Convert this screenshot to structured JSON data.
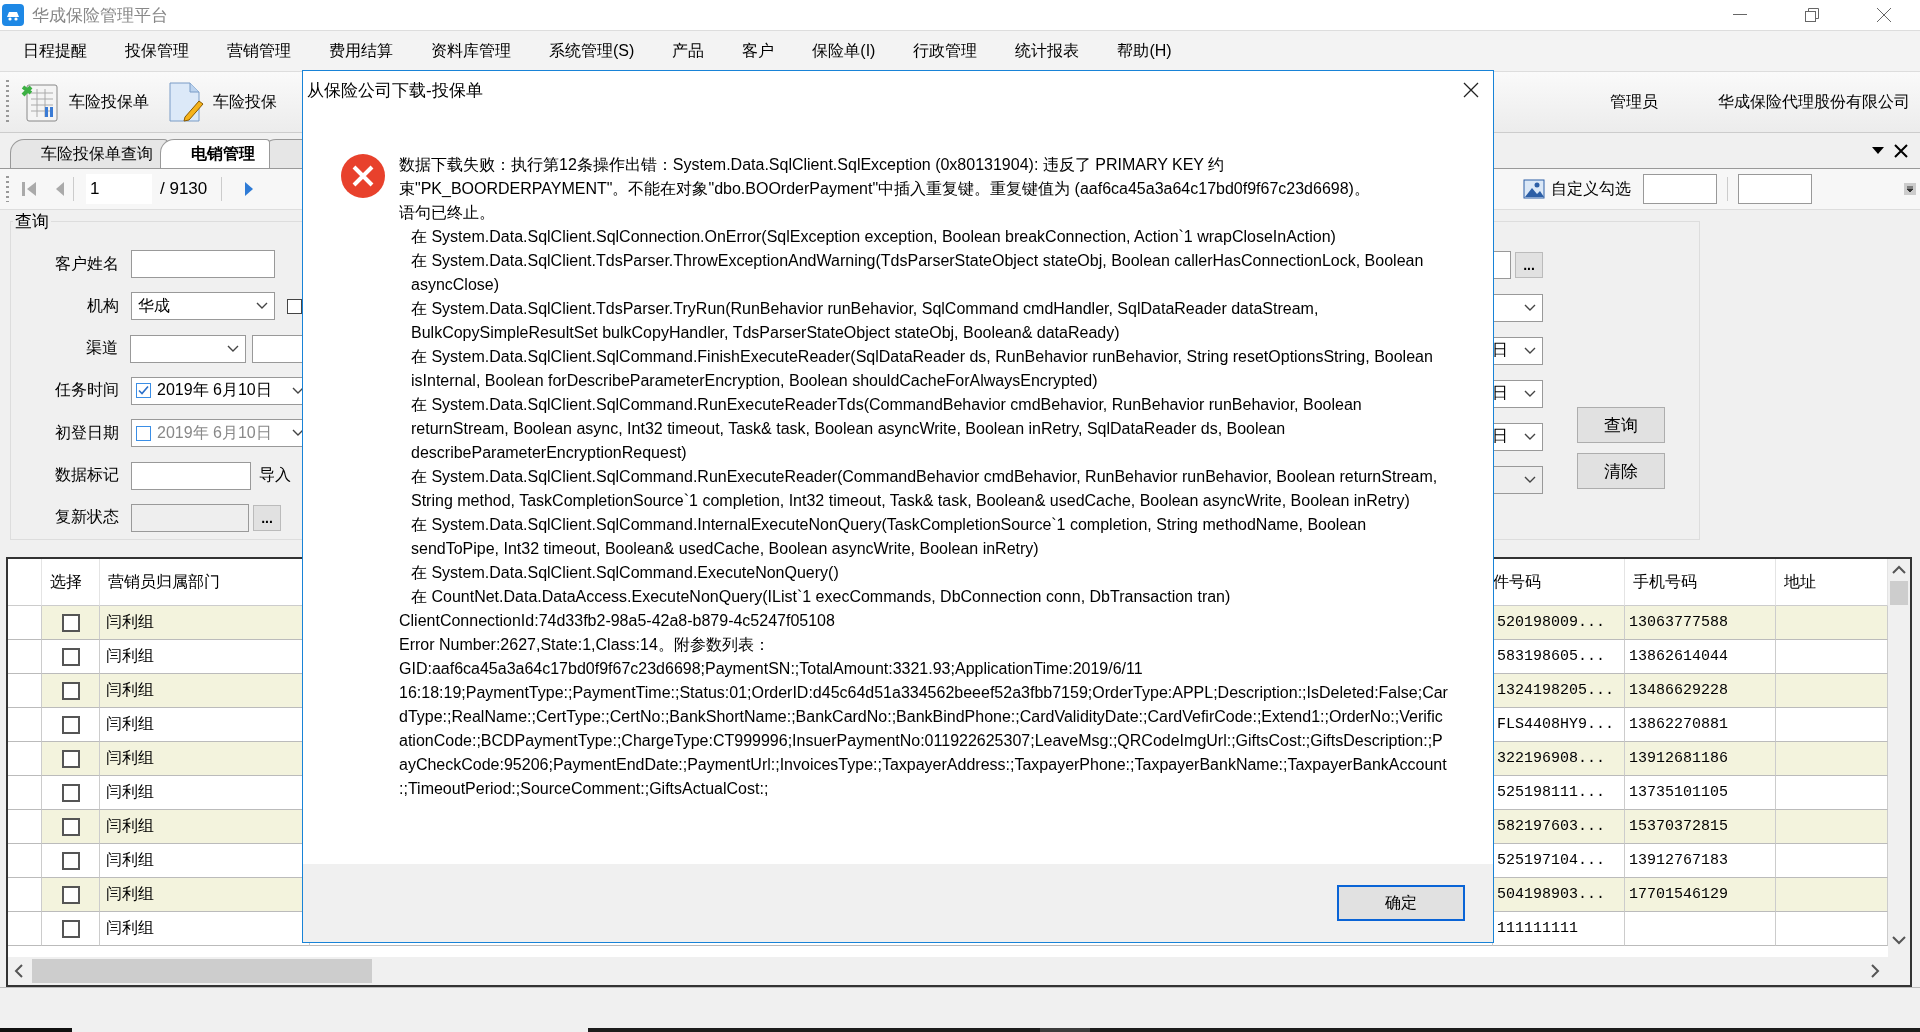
{
  "window": {
    "title": "华成保险管理平台"
  },
  "menu": [
    "日程提醒",
    "投保管理",
    "营销管理",
    "费用结算",
    "资料库管理",
    "系统管理(S)",
    "产品",
    "客户",
    "保险单(I)",
    "行政管理",
    "统计报表",
    "帮助(H)"
  ],
  "toolbar": {
    "buttons": [
      {
        "kind": "sheet",
        "label": "车险投保单"
      },
      {
        "kind": "edit",
        "label": "车险投保"
      }
    ],
    "user": "管理员",
    "company": "华成保险代理股份有限公司"
  },
  "tabs": [
    {
      "label": "车险投保单查询",
      "selected": false
    },
    {
      "label": "电销管理",
      "selected": true
    }
  ],
  "navigator": {
    "page": "1",
    "total": "/ 9130",
    "custom_select": "自定义勾选"
  },
  "query": {
    "title": "查询",
    "fields": [
      {
        "label": "客户姓名",
        "control": {
          "kind": "text"
        }
      },
      {
        "label": "机构",
        "control": {
          "kind": "select",
          "value": "华成"
        },
        "after": {
          "kind": "checkbox",
          "checked": false
        }
      },
      {
        "label": "渠道",
        "control": {
          "kind": "select"
        },
        "after": {
          "kind": "input"
        }
      },
      {
        "label": "任务时间",
        "control": {
          "kind": "date",
          "value": "2019年 6月10日",
          "checked": true
        }
      },
      {
        "label": "初登日期",
        "control": {
          "kind": "date",
          "value": "2019年 6月10日",
          "checked": false
        }
      },
      {
        "label": "数据标记",
        "control": {
          "kind": "text"
        },
        "after": {
          "kind": "label",
          "text": "导入"
        }
      },
      {
        "label": "复新状态",
        "control": {
          "kind": "picker",
          "button": "...",
          "disabled": true
        }
      }
    ],
    "right_fields": [
      {
        "kind": "picker",
        "button": "..."
      },
      {
        "kind": "select"
      },
      {
        "kind": "date",
        "value": "日"
      },
      {
        "kind": "date",
        "value": "日"
      },
      {
        "kind": "date",
        "value": "日"
      },
      {
        "kind": "select",
        "disabled": true
      }
    ],
    "buttons": [
      "查询",
      "清除"
    ]
  },
  "table": {
    "columns": [
      "选择",
      "营销员归属部门",
      "件号码",
      "手机号码",
      "地址"
    ],
    "rows": [
      {
        "checked": false,
        "dept": "闫利组",
        "id": "520198009...",
        "phone": "13063777588"
      },
      {
        "checked": false,
        "dept": "闫利组",
        "id": "583198605...",
        "phone": "13862614044"
      },
      {
        "checked": false,
        "dept": "闫利组",
        "id": "1324198205...",
        "phone": "13486629228"
      },
      {
        "checked": false,
        "dept": "闫利组",
        "id": "FLS4408HY9...",
        "phone": "13862270881"
      },
      {
        "checked": false,
        "dept": "闫利组",
        "id": "322196908...",
        "phone": "13912681186"
      },
      {
        "checked": false,
        "dept": "闫利组",
        "id": "525198111...",
        "phone": "13735101105"
      },
      {
        "checked": false,
        "dept": "闫利组",
        "id": "582197603...",
        "phone": "15370372815"
      },
      {
        "checked": false,
        "dept": "闫利组",
        "id": "525197104...",
        "phone": "13912767183"
      },
      {
        "checked": false,
        "dept": "闫利组",
        "id": "504198903...",
        "phone": "17701546129"
      },
      {
        "checked": false,
        "dept": "闫利组",
        "id": "111111111"
      }
    ]
  },
  "dialog": {
    "title": "从保险公司下载-投保单",
    "lines": [
      {
        "kind": "message",
        "text": "数据下载失败：执行第12条操作出错：System.Data.SqlClient.SqlException (0x80131904): 违反了 PRIMARY KEY 约束\"PK_BOORDERPAYMENT\"。不能在对象\"dbo.BOOrderPayment\"中插入重复键。重复键值为 (aaf6ca45a3a64c17bd0f9f67c23d6698)。"
      },
      {
        "kind": "message",
        "text": "语句已终止。"
      },
      {
        "kind": "frame",
        "text": "在 System.Data.SqlClient.SqlConnection.OnError(SqlException exception, Boolean breakConnection, Action`1 wrapCloseInAction)"
      },
      {
        "kind": "frame",
        "text": "在 System.Data.SqlClient.TdsParser.ThrowExceptionAndWarning(TdsParserStateObject stateObj, Boolean callerHasConnectionLock, Boolean asyncClose)"
      },
      {
        "kind": "frame",
        "text": "在 System.Data.SqlClient.TdsParser.TryRun(RunBehavior runBehavior, SqlCommand cmdHandler, SqlDataReader dataStream, BulkCopySimpleResultSet bulkCopyHandler, TdsParserStateObject stateObj, Boolean& dataReady)"
      },
      {
        "kind": "frame",
        "text": "在 System.Data.SqlClient.SqlCommand.FinishExecuteReader(SqlDataReader ds, RunBehavior runBehavior, String resetOptionsString, Boolean isInternal, Boolean forDescribeParameterEncryption, Boolean shouldCacheForAlwaysEncrypted)"
      },
      {
        "kind": "frame",
        "text": "在 System.Data.SqlClient.SqlCommand.RunExecuteReaderTds(CommandBehavior cmdBehavior, RunBehavior runBehavior, Boolean returnStream, Boolean async, Int32 timeout, Task& task, Boolean asyncWrite, Boolean inRetry, SqlDataReader ds, Boolean describeParameterEncryptionRequest)"
      },
      {
        "kind": "frame",
        "text": "在 System.Data.SqlClient.SqlCommand.RunExecuteReader(CommandBehavior cmdBehavior, RunBehavior runBehavior, Boolean returnStream, String method, TaskCompletionSource`1 completion, Int32 timeout, Task& task, Boolean& usedCache, Boolean asyncWrite, Boolean inRetry)"
      },
      {
        "kind": "frame",
        "text": "在 System.Data.SqlClient.SqlCommand.InternalExecuteNonQuery(TaskCompletionSource`1 completion, String methodName, Boolean sendToPipe, Int32 timeout, Boolean& usedCache, Boolean asyncWrite, Boolean inRetry)"
      },
      {
        "kind": "frame",
        "text": "在 System.Data.SqlClient.SqlCommand.ExecuteNonQuery()"
      },
      {
        "kind": "frame",
        "text": "在 CountNet.Data.DataAccess.ExecuteNonQuery(IList`1 execCommands, DbConnection conn, DbTransaction tran)"
      },
      {
        "kind": "detail",
        "text": "ClientConnectionId:74d33fb2-98a5-42a8-b879-4c5247f05108"
      },
      {
        "kind": "detail",
        "text": "Error Number:2627,State:1,Class:14。附参数列表："
      },
      {
        "kind": "detail",
        "text": "GID:aaf6ca45a3a64c17bd0f9f67c23d6698;PaymentSN:;TotalAmount:3321.93;ApplicationTime:2019/6/11 16:18:19;PaymentType:;PaymentTime:;Status:01;OrderID:d45c64d51a334562beeef52a3fbb7159;OrderType:APPL;Description:;IsDeleted:False;CardType:;RealName:;CertType:;CertNo:;BankShortName:;BankCardNo:;BankBindPhone:;CardValidityDate:;CardVefirCode:;Extend1:;OrderNo:;VerificationCode:;BCDPaymentType:;ChargeType:CT999996;InsuerPaymentNo:011922625307;LeaveMsg:;QRCodeImgUrl:;GiftsCost:;GiftsDescription:;PayCheckCode:95206;PaymentEndDate:;PaymentUrl:;InvoicesType:;TaxpayerAddress:;TaxpayerPhone:;TaxpayerBankName:;TaxpayerBankAccount:;TimeoutPeriod:;SourceComment:;GiftsActualCost:;"
      }
    ],
    "button": "确定"
  }
}
